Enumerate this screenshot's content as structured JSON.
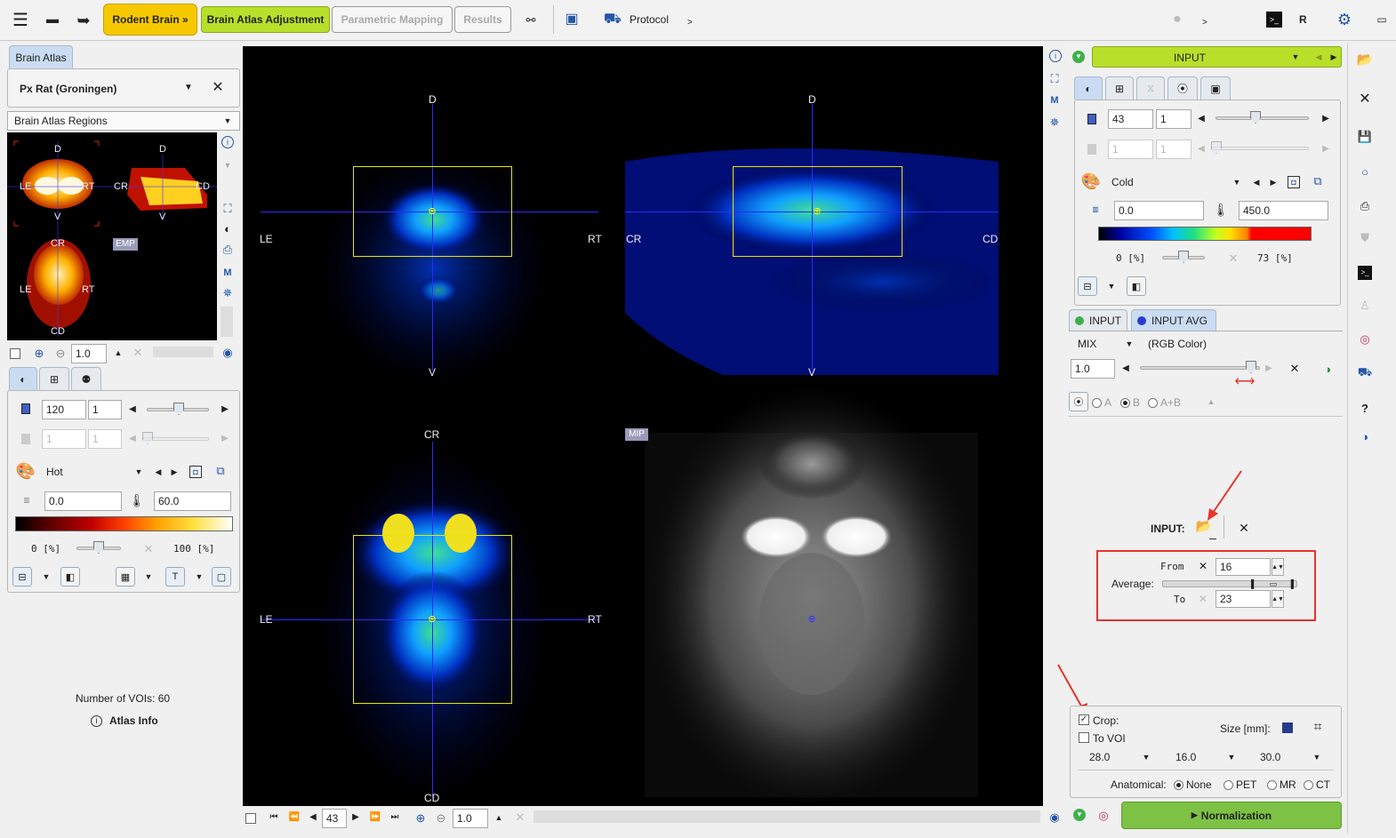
{
  "toolbar": {
    "rodent_brain": "Rodent Brain »",
    "brain_atlas_adjustment": "Brain Atlas Adjustment",
    "parametric_mapping": "Parametric Mapping",
    "results": "Results",
    "protocol": "Protocol",
    "gt1": ">",
    "gt2": ">",
    "r_label": "R"
  },
  "left": {
    "tab": "Brain Atlas",
    "atlas_name": "Px Rat (Groningen)",
    "regions": "Brain Atlas Regions",
    "emp": "EMP",
    "zoom": "1.0",
    "slice": "120",
    "frame": "1",
    "slice2": "1",
    "frame2": "1",
    "colormap": "Hot",
    "min": "0.0",
    "max": "60.0",
    "pct_lo": "0 [%]",
    "pct_hi": "100 [%]",
    "num_vois": "Number of VOIs: 60",
    "atlas_info": "Atlas Info",
    "thumb_labels": {
      "d": "D",
      "v": "V",
      "le": "LE",
      "rt": "RT",
      "cr": "CR",
      "cd": "CD"
    }
  },
  "viewer": {
    "d": "D",
    "v": "V",
    "le": "LE",
    "rt": "RT",
    "cr": "CR",
    "cd": "CD",
    "mip": "MIP",
    "slice": "43",
    "zoom": "1.0"
  },
  "right": {
    "input_label": "INPUT",
    "slice": "43",
    "frame": "1",
    "slice2": "1",
    "frame2": "1",
    "colormap": "Cold",
    "min": "0.0",
    "max": "450.0",
    "pct_lo": "0 [%]",
    "pct_hi": "73 [%]",
    "tab_input": "INPUT",
    "tab_input_avg": "INPUT AVG",
    "mix": "MIX",
    "mix_mode": "(RGB Color)",
    "mix_value": "1.0",
    "radio_a": "A",
    "radio_b": "B",
    "radio_ab": "A+B",
    "input_section": "INPUT:",
    "from_label": "From",
    "from_value": "16",
    "average_label": "Average:",
    "to_label": "To",
    "to_value": "23",
    "crop": "Crop:",
    "to_voi": "To VOI",
    "size_label": "Size [mm]:",
    "size_x": "28.0",
    "size_y": "16.0",
    "size_z": "30.0",
    "anatomical": "Anatomical:",
    "opt_none": "None",
    "opt_pet": "PET",
    "opt_mr": "MR",
    "opt_ct": "CT",
    "normalization": "Normalization"
  },
  "colors": {
    "accent_yellow": "#f5c400",
    "accent_green": "#b8e02a",
    "normalization": "#7dc244",
    "highlight_red": "#e8332b"
  }
}
